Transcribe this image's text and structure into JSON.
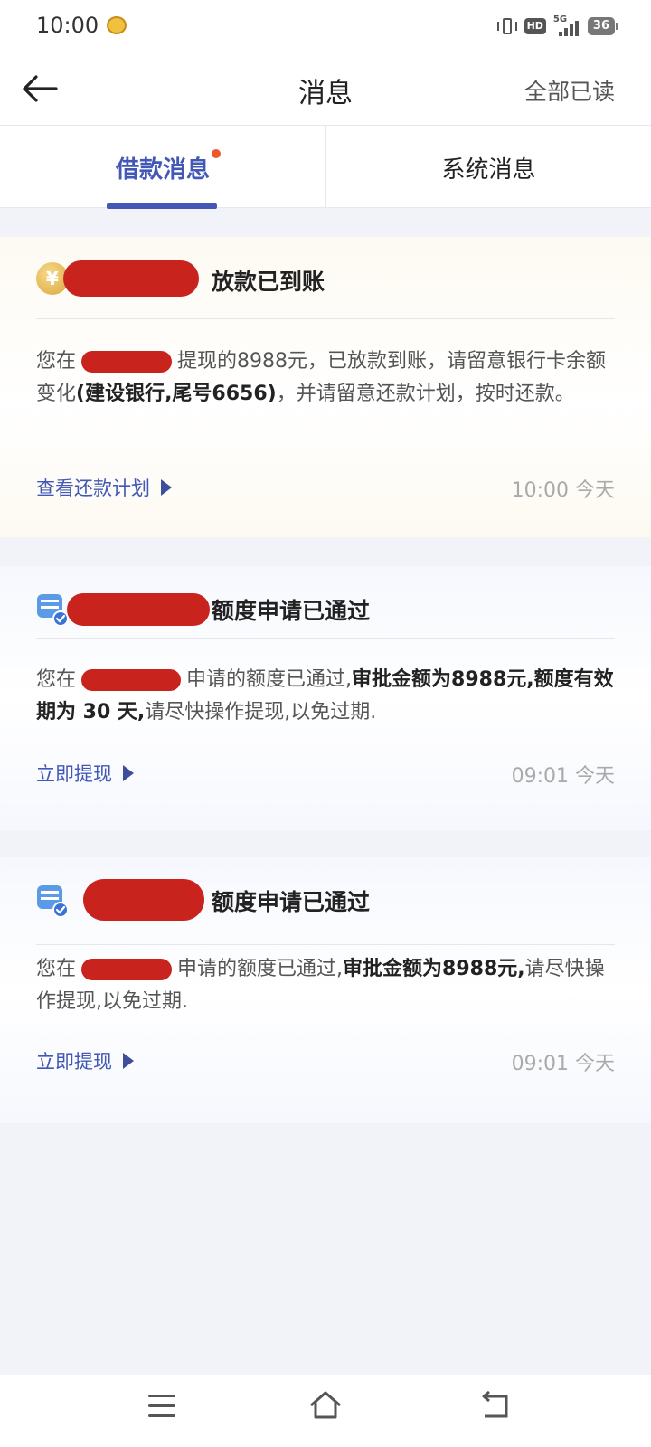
{
  "status_bar": {
    "time": "10:00",
    "hd": "HD",
    "network": "5G",
    "battery": "36"
  },
  "nav": {
    "title": "消息",
    "mark_all_read": "全部已读"
  },
  "tabs": [
    {
      "label": "借款消息",
      "active": true,
      "has_dot": true
    },
    {
      "label": "系统消息",
      "active": false,
      "has_dot": false
    }
  ],
  "messages": [
    {
      "icon": "coin-icon",
      "title": "放款已到账",
      "body_prefix": "您在",
      "body_mid": "提现的8988元，已放款到账，请留意银行卡余额变化",
      "body_bold": "(建设银行,尾号6656)",
      "body_suffix": "，并请留意还款计划，按时还款。",
      "link": "查看还款计划",
      "time": "10:00 今天"
    },
    {
      "icon": "database-check-icon",
      "title": "额度申请已通过",
      "body_prefix": "您在",
      "body_mid": "申请的额度已通过,",
      "body_bold": "审批金额为8988元,额度有效期为 30 天,",
      "body_suffix": "请尽快操作提现,以免过期.",
      "link": "立即提现",
      "time": "09:01 今天"
    },
    {
      "icon": "database-check-icon",
      "title": "额度申请已通过",
      "body_prefix": "您在",
      "body_mid": "申请的额度已通过,",
      "body_bold": "审批金额为8988元,",
      "body_suffix": "请尽快操作提现,以免过期.",
      "link": "立即提现",
      "time": "09:01 今天"
    }
  ],
  "colors": {
    "accent": "#4358b6",
    "dot": "#ec5a2c",
    "redaction": "#c9231e",
    "background": "#f1f3f8"
  }
}
